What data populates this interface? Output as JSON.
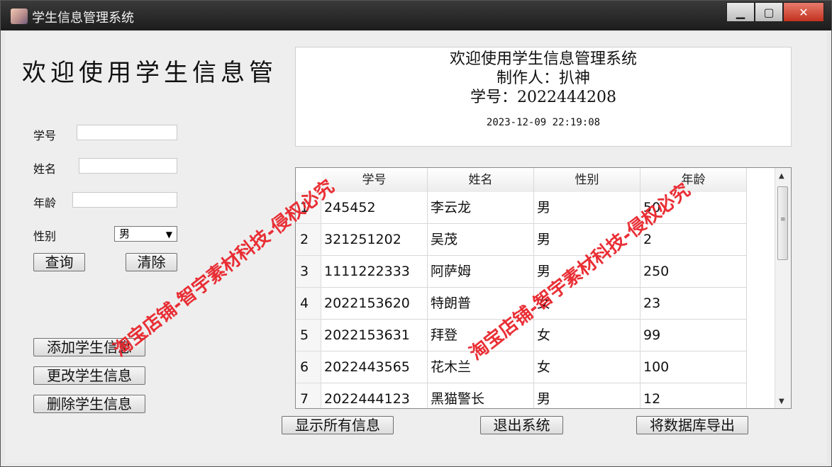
{
  "window": {
    "title": "学生信息管理系统",
    "controls": {
      "minimize": "▁",
      "maximize": "▢",
      "close": "✕"
    }
  },
  "left_panel": {
    "heading": "欢迎使用学生信息管",
    "fields": {
      "student_id_label": "学号",
      "student_id_value": "",
      "name_label": "姓名",
      "name_value": "",
      "age_label": "年龄",
      "age_value": "",
      "gender_label": "性别",
      "gender_selected": "男"
    },
    "buttons": {
      "query": "查询",
      "clear": "清除",
      "add": "添加学生信息",
      "update": "更改学生信息",
      "delete": "删除学生信息"
    }
  },
  "info_panel": {
    "line1": "欢迎使用学生信息管理系统",
    "line2": "制作人：扒神",
    "line3": "学号：2022444208",
    "timestamp": "2023-12-09 22:19:08"
  },
  "table": {
    "columns": [
      "学号",
      "姓名",
      "性别",
      "年龄"
    ],
    "rows": [
      {
        "num": "1",
        "id": "245452",
        "name": "李云龙",
        "gender": "男",
        "age": "50"
      },
      {
        "num": "2",
        "id": "321251202",
        "name": "吴茂",
        "gender": "男",
        "age": "2"
      },
      {
        "num": "3",
        "id": "1111222333",
        "name": "阿萨姆",
        "gender": "男",
        "age": "250"
      },
      {
        "num": "4",
        "id": "2022153620",
        "name": "特朗普",
        "gender": "女",
        "age": "23"
      },
      {
        "num": "5",
        "id": "2022153631",
        "name": "拜登",
        "gender": "女",
        "age": "99"
      },
      {
        "num": "6",
        "id": "2022443565",
        "name": "花木兰",
        "gender": "女",
        "age": "100"
      },
      {
        "num": "7",
        "id": "2022444123",
        "name": "黑猫警长",
        "gender": "男",
        "age": "12"
      }
    ]
  },
  "bottom_buttons": {
    "show_all": "显示所有信息",
    "exit": "退出系统",
    "export": "将数据库导出"
  },
  "watermark": {
    "text_left": "淘宝店铺-智宇素材科技-侵权必究",
    "text_right": "淘宝店铺-智宇素材科技-侵权必究",
    "color": "#e8242b"
  }
}
